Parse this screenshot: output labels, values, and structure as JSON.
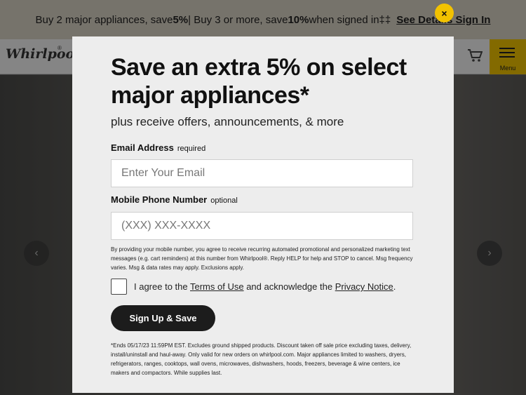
{
  "promo": {
    "text_1": "Buy 2 major appliances, save ",
    "bold_1": "5%",
    "text_2": " | Buy 3 or more, save ",
    "bold_2": "10%",
    "text_3": " when signed in‡‡",
    "link": "See Details Sign In"
  },
  "header": {
    "logo": "Whirlpool",
    "menu_label": "Menu",
    "cart_icon": "cart-icon"
  },
  "carousel": {
    "prev": "‹",
    "next": "›"
  },
  "modal": {
    "title": "Save an extra 5% on select major appliances*",
    "subtitle": "plus receive offers, announcements, & more",
    "email": {
      "label": "Email Address",
      "hint": "required",
      "placeholder": "Enter Your Email"
    },
    "phone": {
      "label": "Mobile Phone Number",
      "hint": "optional",
      "placeholder": "(XXX) XXX-XXXX"
    },
    "consent": "By providing your mobile number, you agree to receive recurring automated promotional and personalized marketing text messages (e.g. cart reminders) at this number from Whirlpool®. Reply HELP for help and STOP to cancel. Msg frequency varies. Msg & data rates may apply. Exclusions apply.",
    "agree": {
      "prefix": "I agree to the ",
      "terms": "Terms of Use",
      "middle": " and acknowledge the ",
      "privacy": "Privacy Notice",
      "suffix": "."
    },
    "button": "Sign Up & Save",
    "fine_print": "*Ends 05/17/23 11:59PM EST. Excludes ground shipped products. Discount taken off sale price excluding taxes, delivery, install/uninstall and haul-away. Only valid for new orders on whirlpool.com. Major appliances limited to washers, dryers, refrigerators, ranges, cooktops, wall ovens, microwaves, dishwashers, hoods, freezers, beverage & wine centers, ice makers and compactors. While supplies last.",
    "close": "×"
  },
  "colors": {
    "accent": "#f2c200",
    "button": "#1c1c1c"
  }
}
